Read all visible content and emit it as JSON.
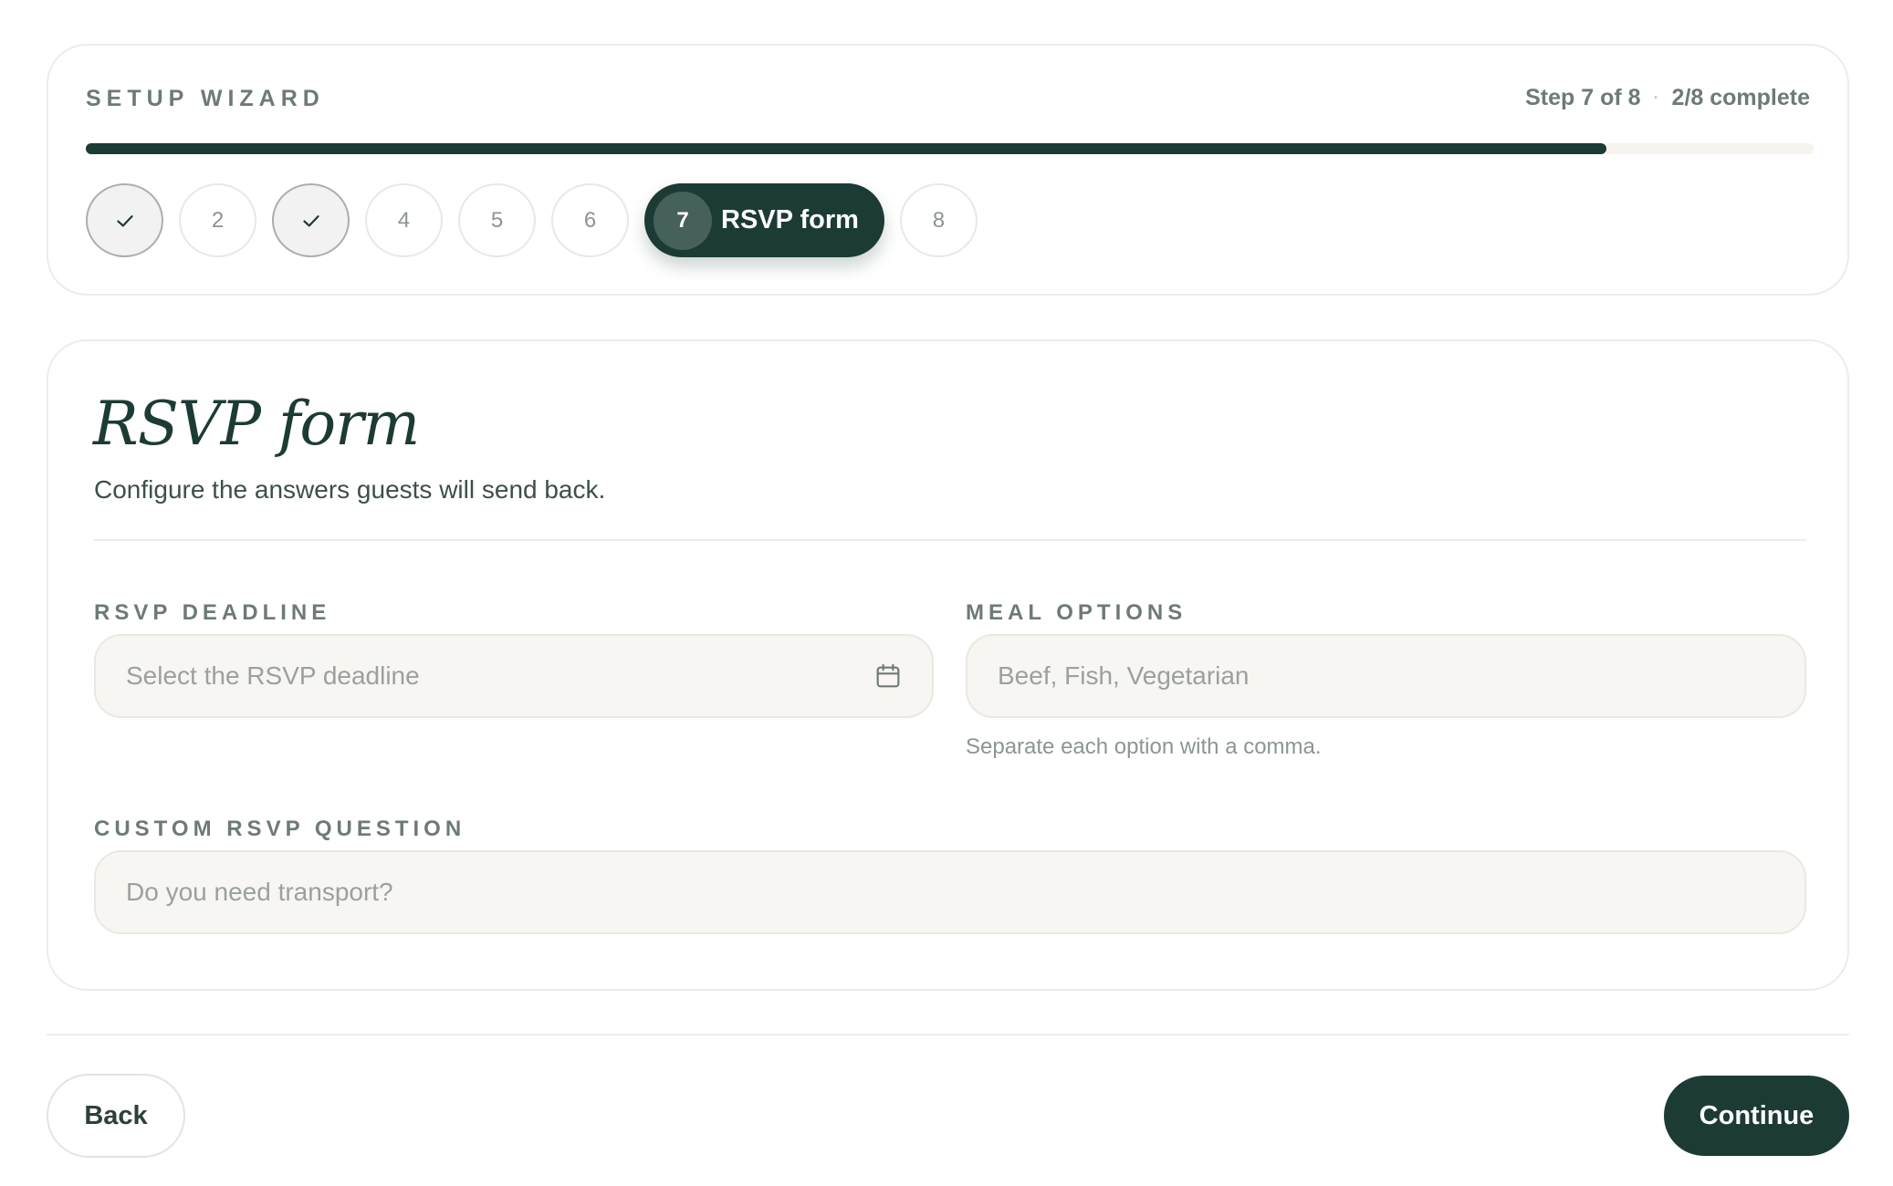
{
  "wizard": {
    "title": "SETUP WIZARD",
    "step_text": "Step 7 of 8",
    "separator": "·",
    "complete_text": "2/8 complete",
    "progress_fraction": 0.88,
    "steps": [
      {
        "number": "1",
        "state": "done",
        "icon": "check-icon"
      },
      {
        "number": "2",
        "state": "pending"
      },
      {
        "number": "3",
        "state": "done",
        "icon": "check-icon"
      },
      {
        "number": "4",
        "state": "pending"
      },
      {
        "number": "5",
        "state": "pending"
      },
      {
        "number": "6",
        "state": "pending"
      },
      {
        "number": "7",
        "state": "active",
        "label": "RSVP form"
      },
      {
        "number": "8",
        "state": "pending"
      }
    ]
  },
  "form": {
    "title": "RSVP form",
    "subtitle": "Configure the answers guests will send back.",
    "deadline": {
      "label": "RSVP DEADLINE",
      "placeholder": "Select the RSVP deadline",
      "value": "",
      "icon": "calendar-icon"
    },
    "meal_options": {
      "label": "MEAL OPTIONS",
      "placeholder": "Beef, Fish, Vegetarian",
      "value": "",
      "hint": "Separate each option with a comma."
    },
    "custom_question": {
      "label": "CUSTOM RSVP QUESTION",
      "placeholder": "Do you need transport?",
      "value": ""
    }
  },
  "footer": {
    "back_label": "Back",
    "continue_label": "Continue"
  },
  "colors": {
    "accent": "#1c3b35",
    "field_bg": "#f8f6f2",
    "muted_text": "#6d7a78"
  }
}
